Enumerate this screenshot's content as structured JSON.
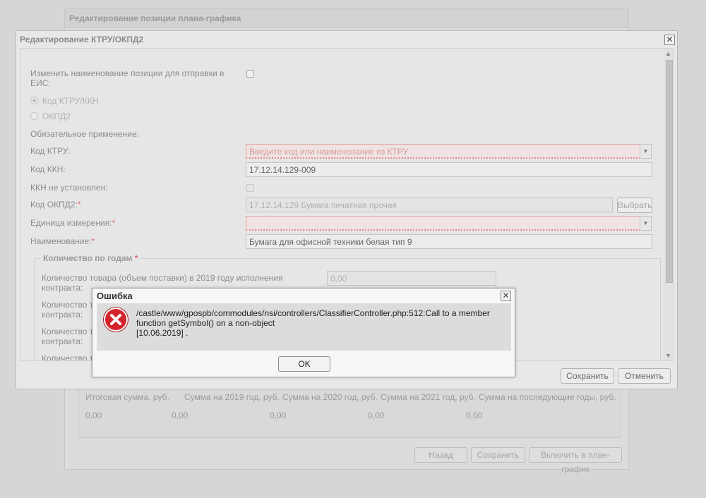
{
  "background": {
    "title": "Редактирование позиции плана-графика",
    "sum_headers": [
      "Итоговая сумма, руб.",
      "Сумма на 2019 год, руб.",
      "Сумма на 2020 год, руб.",
      "Сумма на 2021 год, руб.",
      "Сумма на последующие годы, руб."
    ],
    "sum_values": [
      "0,00",
      "0,00",
      "0,00",
      "0,00",
      "0,00"
    ],
    "buttons": {
      "back": "Назад",
      "save": "Сохранить",
      "include": "Включить в план-график"
    }
  },
  "dialog": {
    "title": "Редактирование КТРУ/ОКПД2",
    "rename_label": "Изменить наименование позиции для отправки в ЕИС:",
    "radio_ktru": "Код КТРУ/ККН",
    "radio_okpd": "ОКПД2",
    "mandatory_label": "Обязательное применение:",
    "ktru_label": "Код КТРУ:",
    "ktru_placeholder": "Введите код или наименование из КТРУ",
    "kkn_label": "Код ККН:",
    "kkn_value": "17.12.14.129-009",
    "kkn_unset_label": "ККН не установлен:",
    "okpd_label": "Код ОКПД2:",
    "okpd_value": "17.12.14.129 Бумага печатная прочая",
    "choose_button": "Выбрать",
    "unit_label": "Единица измерения:",
    "name_label": "Наименование:",
    "name_value": "Бумага для офисной техники белая тип 9",
    "required_mark": "*",
    "years_legend": "Количество по годам",
    "qty_row1_label": "Количество товара (объем поставки) в 2019 году исполнения контракта:",
    "qty_row1_value": "0,00",
    "qty_partial_a": "Количество то",
    "qty_partial_b": "контракта:",
    "save_button": "Сохранить",
    "cancel_button": "Отменить"
  },
  "error": {
    "title": "Ошибка",
    "message_line1": "/castle/www/gpospb/commodules/nsi/controllers/ClassifierController.php:512:Call to a member",
    "message_line2": "function getSymbol() on a non-object",
    "message_line3": "[10.06.2019] .",
    "ok_button": "OK"
  },
  "icons": {
    "close": "close-icon",
    "dropdown": "chevron-down-icon",
    "error": "error-icon"
  },
  "colors": {
    "error_red": "#d4242b",
    "invalid_field_border": "#e4a5a5"
  }
}
